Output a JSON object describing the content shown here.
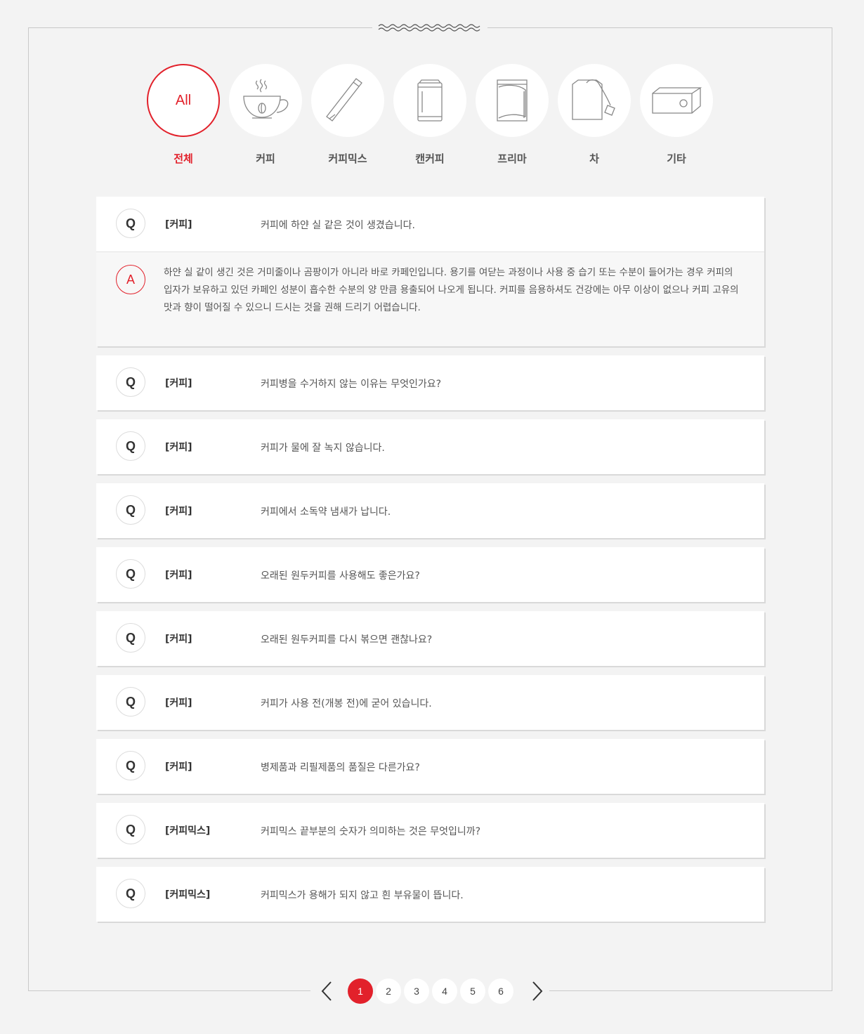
{
  "categories": [
    {
      "label": "전체",
      "badge": "All",
      "icon": "all-icon",
      "active": true
    },
    {
      "label": "커피",
      "icon": "coffee-cup-icon"
    },
    {
      "label": "커피믹스",
      "icon": "coffee-stick-icon"
    },
    {
      "label": "캔커피",
      "icon": "can-icon"
    },
    {
      "label": "프리마",
      "icon": "creamer-bag-icon"
    },
    {
      "label": "차",
      "icon": "tea-bag-icon"
    },
    {
      "label": "기타",
      "icon": "box-icon"
    }
  ],
  "faq": [
    {
      "q_badge": "Q",
      "category": "[커피]",
      "question": "커피에 하얀 실 같은 것이 생겼습니다.",
      "expanded": true,
      "a_badge": "A",
      "answer": "하얀 실 같이 생긴 것은 거미줄이나 곰팡이가 아니라 바로 카페인입니다. 용기를 여닫는 과정이나 사용 중 습기 또는 수분이 들어가는 경우 커피의 입자가 보유하고 있던 카페인 성분이 흡수한 수분의 양 만큼 용출되어 나오게 됩니다. 커피를 음용하셔도 건강에는 아무 이상이 없으나 커피 고유의 맛과 향이 떨어질 수 있으니 드시는 것을 권해 드리기 어렵습니다."
    },
    {
      "q_badge": "Q",
      "category": "[커피]",
      "question": "커피병을 수거하지 않는 이유는 무엇인가요?"
    },
    {
      "q_badge": "Q",
      "category": "[커피]",
      "question": "커피가 물에 잘 녹지 않습니다."
    },
    {
      "q_badge": "Q",
      "category": "[커피]",
      "question": "커피에서 소독약 냄새가 납니다."
    },
    {
      "q_badge": "Q",
      "category": "[커피]",
      "question": "오래된 원두커피를 사용해도 좋은가요?"
    },
    {
      "q_badge": "Q",
      "category": "[커피]",
      "question": "오래된 원두커피를 다시 볶으면 괜찮나요?"
    },
    {
      "q_badge": "Q",
      "category": "[커피]",
      "question": "커피가 사용 전(개봉 전)에 굳어 있습니다."
    },
    {
      "q_badge": "Q",
      "category": "[커피]",
      "question": "병제품과 리필제품의 품질은 다른가요?"
    },
    {
      "q_badge": "Q",
      "category": "[커피믹스]",
      "question": "커피믹스 끝부분의 숫자가 의미하는 것은 무엇입니까?"
    },
    {
      "q_badge": "Q",
      "category": "[커피믹스]",
      "question": "커피믹스가 용해가 되지 않고 흰 부유물이 뜹니다."
    }
  ],
  "pagination": {
    "pages": [
      "1",
      "2",
      "3",
      "4",
      "5",
      "6"
    ],
    "current": "1",
    "prev_icon": "chevron-left-icon",
    "next_icon": "chevron-right-icon"
  },
  "colors": {
    "accent": "#e2212b",
    "background": "#f3f3f3",
    "line": "#c9c9c9"
  }
}
